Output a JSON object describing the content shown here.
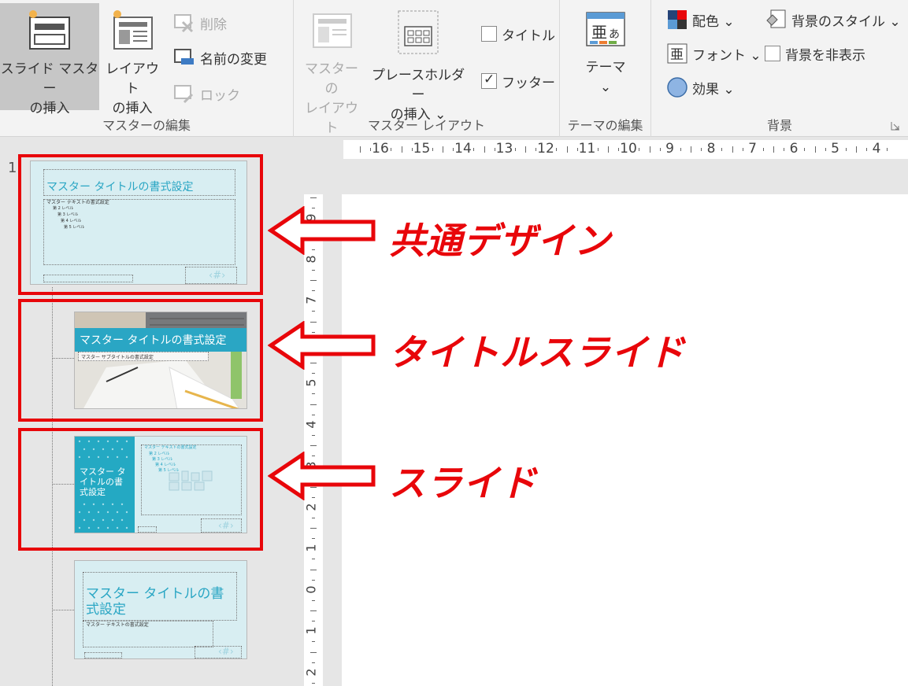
{
  "ribbon": {
    "master_edit": {
      "group_label": "マスターの編集",
      "insert_slide_master": [
        "スライド マスター",
        "の挿入"
      ],
      "insert_layout": [
        "レイアウト",
        "の挿入"
      ],
      "delete": "削除",
      "rename": "名前の変更",
      "lock": "ロック"
    },
    "master_layout": {
      "group_label": "マスター レイアウト",
      "master_layout_btn": [
        "マスターの",
        "レイアウト"
      ],
      "insert_placeholder": [
        "プレースホルダー",
        "の挿入 ⌄"
      ],
      "title_check": "タイトル",
      "footer_check": "フッター"
    },
    "theme_edit": {
      "group_label": "テーマの編集",
      "themes": "テーマ",
      "theme_arrow": "⌄"
    },
    "background": {
      "group_label": "背景",
      "colors": "配色 ⌄",
      "fonts": "フォント ⌄",
      "effects": "効果 ⌄",
      "bg_styles": "背景のスタイル ⌄",
      "hide_bg": "背景を非表示"
    }
  },
  "ruler": {
    "h_ticks": [
      "16",
      "15",
      "14",
      "13",
      "12",
      "11",
      "10",
      "9",
      "8",
      "7",
      "6",
      "5",
      "4"
    ],
    "v_ticks": [
      "9",
      "8",
      "7",
      "6",
      "5",
      "4",
      "3",
      "2",
      "1",
      "0",
      "1",
      "2"
    ]
  },
  "thumbnails": {
    "slide_number": "1",
    "master": {
      "title": "マスター タイトルの書式設定",
      "body": [
        "マスター テキストの書式設定",
        "第 2 レベル",
        "第 3 レベル",
        "第 4 レベル",
        "第 5 レベル"
      ],
      "page_num": "‹#›"
    },
    "title_slide": {
      "title": "マスター タイトルの書式設定",
      "subtitle": "マスター サブタイトルの書式設定"
    },
    "content_slide": {
      "title": "マスター タイトルの書式設定",
      "body": [
        "マスター テキストの書式設定",
        "第 2 レベル",
        "第 3 レベル",
        "第 4 レベル",
        "第 5 レベル"
      ],
      "page_num": "‹#›"
    },
    "layout4": {
      "title": "マスター タイトルの書式設定",
      "body": "マスター テキストの書式設定",
      "page_num": "‹#›"
    }
  },
  "annotations": {
    "common_design": "共通デザイン",
    "title_slide": "タイトルスライド",
    "slide": "スライド"
  },
  "colors": {
    "accent_red": "#e8060a",
    "teal": "#2aa6c4",
    "slide_bg": "#d8eef2"
  }
}
